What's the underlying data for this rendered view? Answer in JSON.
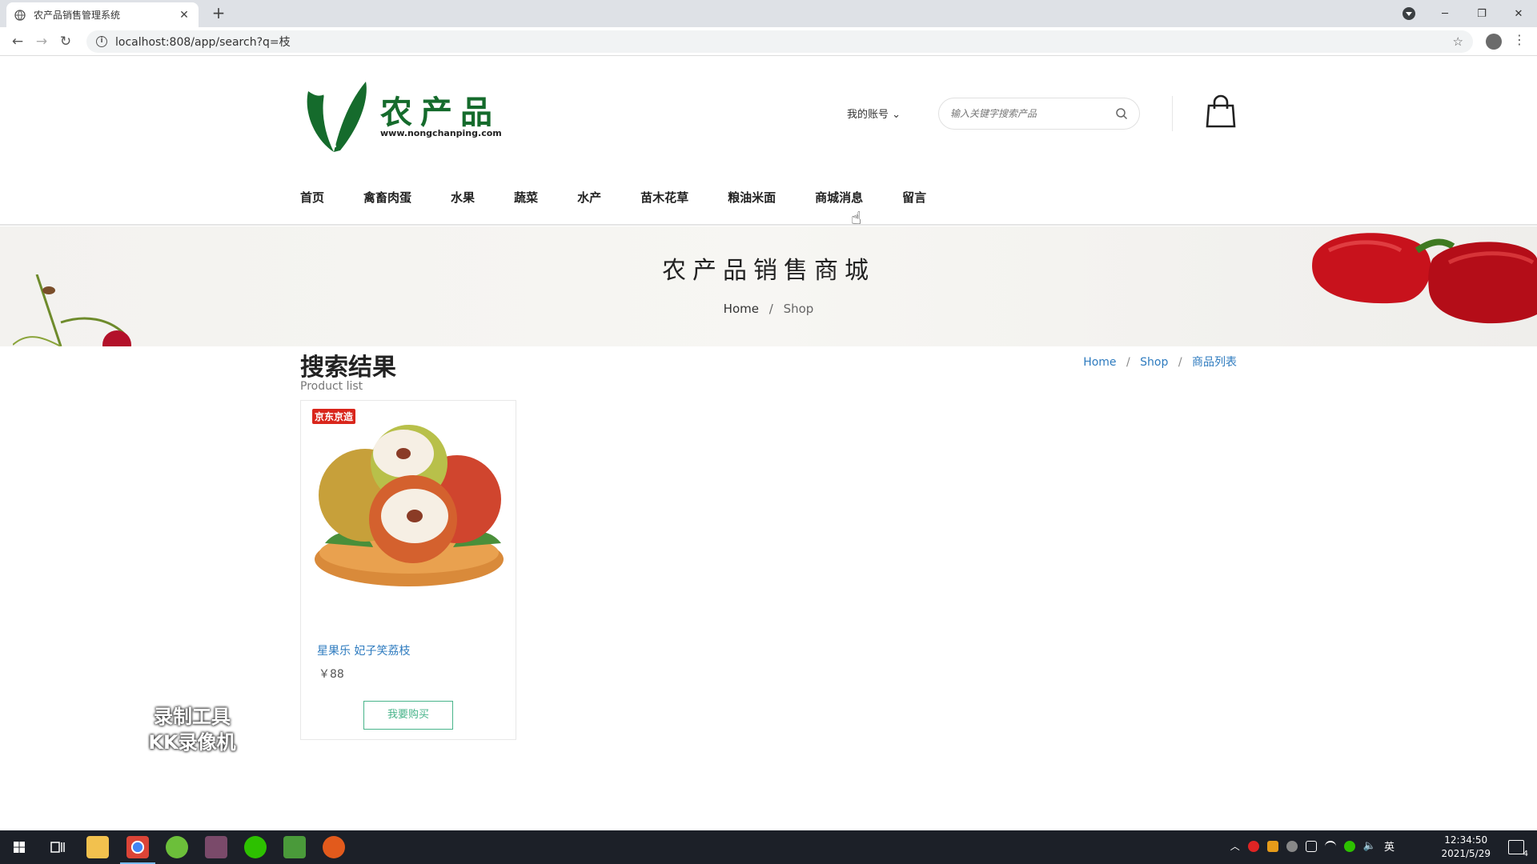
{
  "browser": {
    "tab_title": "农产品销售管理系统",
    "tab_close": "✕",
    "new_tab": "+",
    "url": "localhost:808/app/search?q=枝",
    "back": "←",
    "forward": "→",
    "reload": "↻",
    "star": "☆",
    "menu": "⋮",
    "minimize": "─",
    "restore": "❐",
    "close": "✕"
  },
  "header": {
    "logo_text": "农产品",
    "logo_url": "www.nongchanping.com",
    "account_label": "我的账号 ⌄",
    "search_placeholder": "输入关键字搜索产品"
  },
  "nav": {
    "items": [
      "首页",
      "禽畜肉蛋",
      "水果",
      "蔬菜",
      "水产",
      "苗木花草",
      "粮油米面",
      "商城消息",
      "留言"
    ]
  },
  "banner": {
    "title": "农产品销售商城",
    "crumb_home": "Home",
    "crumb_sep": "/",
    "crumb_current": "Shop"
  },
  "content": {
    "heading": "搜索结果",
    "subheading": "Product list",
    "crumb": {
      "home": "Home",
      "shop": "Shop",
      "current": "商品列表",
      "sep": "/"
    }
  },
  "products": [
    {
      "brand_tag": "京东京造",
      "name": "星果乐 妃子笑荔枝",
      "price": "￥88",
      "buy_label": "我要购买"
    }
  ],
  "watermark": {
    "line1": "录制工具",
    "line2": "KK录像机"
  },
  "taskbar": {
    "lang": "英",
    "time": "12:34:50",
    "date": "2021/5/29",
    "notification_count": "4"
  },
  "colors": {
    "brand_green": "#156b2c",
    "link_blue": "#2e7bbf",
    "button_green": "#48b48a",
    "tag_red": "#d9261c"
  }
}
